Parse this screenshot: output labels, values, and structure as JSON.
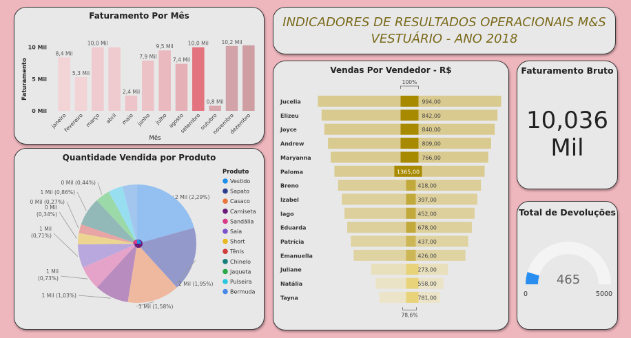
{
  "header": {
    "title_line1": "INDICADORES DE RESULTADOS OPERACIONAIS M&S",
    "title_line2": "VESTUÁRIO - ANO 2018"
  },
  "kpi_faturamento": {
    "title": "Faturamento Bruto",
    "value": "10,036",
    "unit": "Mil"
  },
  "kpi_devolucoes": {
    "title": "Total de Devoluções",
    "value": "465",
    "min": "0",
    "max": "5000"
  },
  "colors": {
    "background": "#eeb6bd",
    "card": "#e8e8e8",
    "gold": "#a88a00",
    "title_gold": "#7a6a1c",
    "gauge_blue": "#2a8ef0"
  },
  "chart_data": [
    {
      "type": "bar",
      "title": "Faturamento Por Mês",
      "xlabel": "Mês",
      "ylabel": "Faturamento",
      "ylim": [
        0,
        10.5
      ],
      "yticks": [
        "0 Mil",
        "5 Mil",
        "10 Mil"
      ],
      "categories": [
        "janeiro",
        "fevereiro",
        "março",
        "abril",
        "maio",
        "junho",
        "julho",
        "agosto",
        "setembro",
        "outubro",
        "novembro",
        "dezembro"
      ],
      "values": [
        8.4,
        5.3,
        10.0,
        10.0,
        2.4,
        7.9,
        9.5,
        7.4,
        10.0,
        0.8,
        10.2,
        10.3
      ],
      "labels": [
        "8,4 Mil",
        "5,3 Mil",
        "10,0 Mil",
        "",
        "2,4 Mil",
        "7,9 Mil",
        "9,5 Mil",
        "7,4 Mil",
        "10,0 Mil",
        "0,8 Mil",
        "10,2 Mil",
        ""
      ],
      "colors": [
        "#f2d3d6",
        "#f2d3d6",
        "#efcbcf",
        "#efcbcf",
        "#edc4c9",
        "#ecc2c7",
        "#e9b9bf",
        "#e6b0b7",
        "#e2737f",
        "#d9a7ad",
        "#d2a3a8",
        "#cf9ea3"
      ]
    },
    {
      "type": "pie",
      "title": "Quantidade Vendida por Produto",
      "legend_title": "Produto",
      "legend_position": "right",
      "categories": [
        "Vestido",
        "Sapato",
        "Casaco",
        "Camiseta",
        "Sandália",
        "Saia",
        "Short",
        "Tênis",
        "Chinelo",
        "Jaqueta",
        "Pulseira",
        "Bermuda"
      ],
      "legend_colors": [
        "#1e90e8",
        "#2b3d8c",
        "#e8763c",
        "#6a1b7a",
        "#d63c8a",
        "#7b52c8",
        "#e8b81c",
        "#d13c3c",
        "#1b7c7c",
        "#2aa84a",
        "#2ac8e0",
        "#4a88e8"
      ],
      "slices": [
        {
          "value": 2.29,
          "label": "2 Mil (2,29%)",
          "color": "#93c0f0"
        },
        {
          "value": 1.95,
          "label": "2 Mil (1,95%)",
          "color": "#9499cc"
        },
        {
          "value": 1.58,
          "label": "1 Mil (1,58%)",
          "color": "#efb9a0"
        },
        {
          "value": 1.03,
          "label": "1 Mil (1,03%)",
          "color": "#b88cbe"
        },
        {
          "value": 0.73,
          "label": "1 Mil (0,73%)",
          "color": "#e6a3c9"
        },
        {
          "value": 0.71,
          "label": "1 Mil (0,71%)",
          "color": "#b9a8de"
        },
        {
          "value": 0.34,
          "label": "0 Mil (0,34%)",
          "color": "#ecd590"
        },
        {
          "value": 0.27,
          "label": "0 Mil (0,27%)",
          "color": "#e8a5a5"
        },
        {
          "value": 0.86,
          "label": "1 Mil (0,86%)",
          "color": "#93b8b8"
        },
        {
          "value": 0.44,
          "label": "0 Mil (0,44%)",
          "color": "#9cd9a9"
        },
        {
          "value": 0.44,
          "label": "",
          "color": "#97dff0"
        },
        {
          "value": 0.44,
          "label": "",
          "color": "#a3c6ef"
        }
      ]
    },
    {
      "type": "funnel",
      "title": "Vendas Por Vendedor - R$",
      "top_label": "100%",
      "bottom_label": "78,6%",
      "rows": [
        {
          "name": "Jucelia",
          "value": 994.0,
          "label": "994,00"
        },
        {
          "name": "Elizeu",
          "value": 842.0,
          "label": "842,00"
        },
        {
          "name": "Joyce",
          "value": 840.0,
          "label": "840,00"
        },
        {
          "name": "Andrew",
          "value": 809.0,
          "label": "809,00"
        },
        {
          "name": "Maryanna",
          "value": 766.0,
          "label": "766,00"
        },
        {
          "name": "Paloma",
          "value": 1365.0,
          "label": "1365,00"
        },
        {
          "name": "Breno",
          "value": 418.0,
          "label": "418,00"
        },
        {
          "name": "Izabel",
          "value": 397.0,
          "label": "397,00"
        },
        {
          "name": "Iago",
          "value": 452.0,
          "label": "452,00"
        },
        {
          "name": "Eduarda",
          "value": 678.0,
          "label": "678,00"
        },
        {
          "name": "Patrícia",
          "value": 437.0,
          "label": "437,00"
        },
        {
          "name": "Emanuella",
          "value": 426.0,
          "label": "426,00"
        },
        {
          "name": "Juliane",
          "value": 273.0,
          "label": "273,00"
        },
        {
          "name": "Natália",
          "value": 558.0,
          "label": "558,00"
        },
        {
          "name": "Tayna",
          "value": 781.0,
          "label": "781,00"
        }
      ],
      "outer_share": [
        1.0,
        0.96,
        0.93,
        0.89,
        0.86,
        0.82,
        0.78,
        0.74,
        0.71,
        0.68,
        0.64,
        0.61,
        0.42,
        0.37,
        0.33
      ],
      "outer_colors": [
        "#d9ca8f",
        "#d9ca8f",
        "#d9ca8f",
        "#d9ca8f",
        "#d9ca8f",
        "#dacb92",
        "#dcce98",
        "#ddd09c",
        "#ddd09c",
        "#ddd09c",
        "#e0d3a2",
        "#e0d3a2",
        "#e8dfbd",
        "#ebe3c6",
        "#ece4c8"
      ],
      "inner_colors": [
        "#a88a00",
        "#a88a00",
        "#a88a00",
        "#a88a00",
        "#a88a00",
        "#a88a00",
        "#c2a93c",
        "#c2a93c",
        "#c2a93c",
        "#c2a93c",
        "#cdb655",
        "#cdb655",
        "#e8d37a",
        "#e8d37a",
        "#e8d37a"
      ]
    }
  ]
}
